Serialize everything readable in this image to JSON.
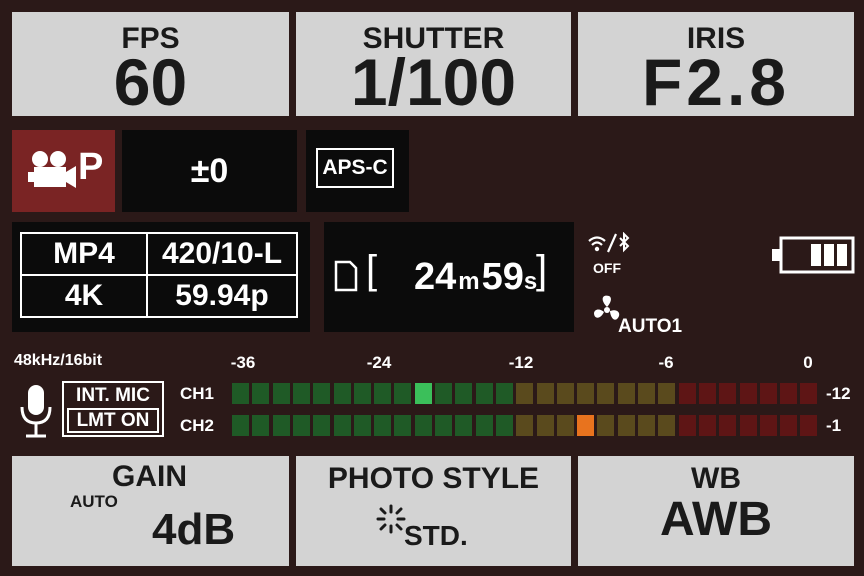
{
  "top": {
    "fps": {
      "label": "FPS",
      "value": "60"
    },
    "shutter": {
      "label": "SHUTTER",
      "value": "1/100"
    },
    "iris": {
      "label": "IRIS",
      "value": "F2.8"
    }
  },
  "mode": {
    "letter": "P",
    "icon": "movie-camera-icon"
  },
  "exposure_comp": "±0",
  "sensor_mode": "APS-C",
  "format": {
    "container": "MP4",
    "sampling": "420/10-L",
    "resolution": "4K",
    "frame_rate": "59.94p"
  },
  "record_time": {
    "minutes": "24",
    "minutes_unit": "m",
    "seconds": "59",
    "seconds_unit": "s"
  },
  "wireless": {
    "status": "OFF",
    "icon": "wifi-bluetooth-icon"
  },
  "battery": {
    "icon": "battery-icon",
    "bars": 3
  },
  "fan": {
    "label": "AUTO1",
    "icon": "fan-icon"
  },
  "audio": {
    "spec": "48kHz/16bit",
    "mic_label": "INT. MIC",
    "limiter_label": "LMT ON",
    "scale": [
      "-36",
      "-24",
      "-12",
      "-6",
      "0"
    ],
    "channels": [
      {
        "label": "CH1",
        "peak": "-12",
        "active_index": 9,
        "active_color": "#3bbf5a"
      },
      {
        "label": "CH2",
        "peak": "-1",
        "active_index": 17,
        "active_color": "#e8731e"
      }
    ],
    "segment_colors": {
      "green": "#1f5a26",
      "amber": "#5a4a1d",
      "red": "#5e1515"
    }
  },
  "bottom": {
    "gain": {
      "label": "GAIN",
      "sub": "AUTO",
      "value": "4dB"
    },
    "photo_style": {
      "label": "PHOTO STYLE",
      "value": "STD."
    },
    "wb": {
      "label": "WB",
      "value": "AWB"
    }
  }
}
